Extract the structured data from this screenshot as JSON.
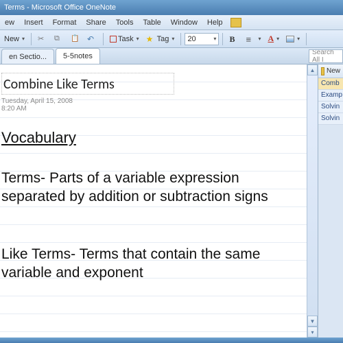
{
  "window": {
    "title": "Terms - Microsoft Office OneNote"
  },
  "menu": {
    "items": [
      "ew",
      "Insert",
      "Format",
      "Share",
      "Tools",
      "Table",
      "Window",
      "Help"
    ]
  },
  "toolbar": {
    "new_label": "New",
    "task_label": "Task",
    "tag_label": "Tag",
    "font_size": "20"
  },
  "tabs": {
    "left": "en Sectio...",
    "active": "5-5notes"
  },
  "search": {
    "placeholder": "Search All I"
  },
  "page": {
    "title": "Combine Like Terms",
    "date": "Tuesday, April 15, 2008",
    "time": "8:20 AM",
    "heading": "Vocabulary",
    "para1": "Terms- Parts of a variable expression separated by addition or subtraction signs",
    "para2": "Like Terms- Terms that contain the same variable and exponent"
  },
  "sidepanel": {
    "new_label": "New",
    "items": [
      "Comb",
      "Examp",
      "Solvin",
      "Solvin"
    ]
  }
}
